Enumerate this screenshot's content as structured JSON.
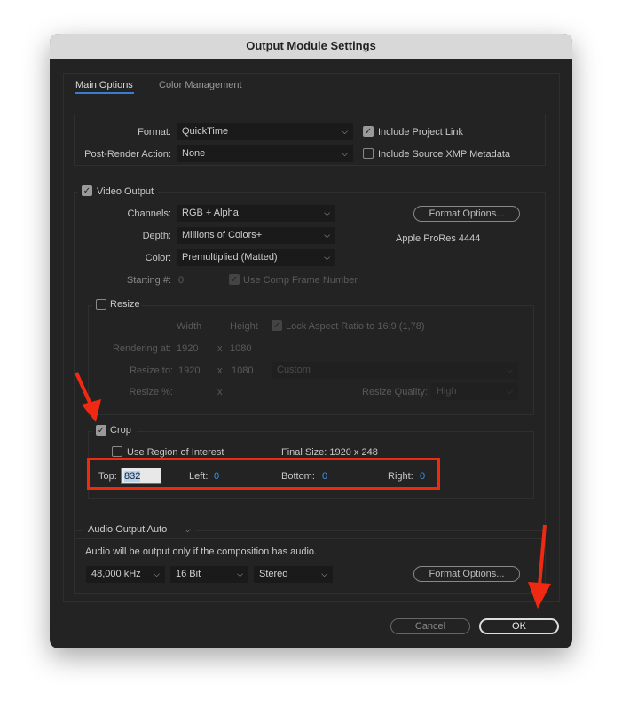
{
  "window": {
    "title": "Output Module Settings"
  },
  "tabs": [
    {
      "label": "Main Options",
      "active": true
    },
    {
      "label": "Color Management",
      "active": false
    }
  ],
  "format": {
    "label": "Format:",
    "value": "QuickTime"
  },
  "post_render": {
    "label": "Post-Render Action:",
    "value": "None"
  },
  "include_project_link": {
    "label": "Include Project Link",
    "checked": true
  },
  "include_xmp": {
    "label": "Include Source XMP Metadata",
    "checked": false
  },
  "video_output": {
    "label": "Video Output",
    "checked": true,
    "channels": {
      "label": "Channels:",
      "value": "RGB + Alpha"
    },
    "depth": {
      "label": "Depth:",
      "value": "Millions of Colors+"
    },
    "color": {
      "label": "Color:",
      "value": "Premultiplied (Matted)"
    },
    "starting": {
      "label": "Starting #:",
      "value": "0"
    },
    "use_comp_frame": {
      "label": "Use Comp Frame Number",
      "checked": true
    },
    "format_options": "Format Options...",
    "codec": "Apple ProRes 4444"
  },
  "resize": {
    "label": "Resize",
    "checked": false,
    "width": "Width",
    "height": "Height",
    "x": "x",
    "lock": {
      "label": "Lock Aspect Ratio to 16:9 (1,78)",
      "checked": true
    },
    "rendering_at": {
      "label": "Rendering at:",
      "w": "1920",
      "h": "1080"
    },
    "resize_to": {
      "label": "Resize to:",
      "w": "1920",
      "h": "1080",
      "preset": "Custom"
    },
    "resize_pct": {
      "label": "Resize %:"
    },
    "quality": {
      "label": "Resize Quality:",
      "value": "High"
    }
  },
  "crop": {
    "label": "Crop",
    "checked": true,
    "roi": {
      "label": "Use Region of Interest",
      "checked": false
    },
    "final_size": "Final Size: 1920 x 248",
    "top": {
      "label": "Top:",
      "value": "832"
    },
    "left": {
      "label": "Left:",
      "value": "0"
    },
    "bottom": {
      "label": "Bottom:",
      "value": "0"
    },
    "right": {
      "label": "Right:",
      "value": "0"
    }
  },
  "audio": {
    "mode": "Audio Output Auto",
    "note": "Audio will be output only if the composition has audio.",
    "rate": "48,000 kHz",
    "bits": "16 Bit",
    "channels": "Stereo",
    "format_options": "Format Options..."
  },
  "buttons": {
    "cancel": "Cancel",
    "ok": "OK"
  },
  "annotation_color": "#f02a12"
}
